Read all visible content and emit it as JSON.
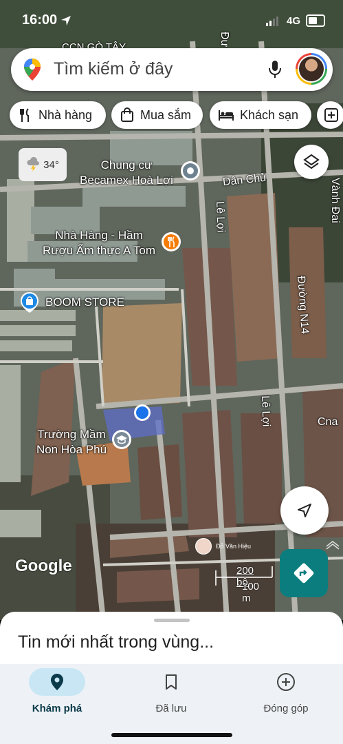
{
  "status_bar": {
    "time": "16:00",
    "network": "4G"
  },
  "search": {
    "placeholder": "Tìm kiếm ở đây"
  },
  "chips": [
    {
      "label": "Nhà hàng",
      "icon": "fork-knife-icon"
    },
    {
      "label": "Mua sắm",
      "icon": "shopping-bag-icon"
    },
    {
      "label": "Khách sạn",
      "icon": "bed-icon"
    },
    {
      "label": "",
      "icon": "plus-box-icon"
    }
  ],
  "weather": {
    "temperature": "34°",
    "icon": "thunderstorm-icon"
  },
  "map_labels": {
    "top_clipped": "CCN GÒ TÂY",
    "condo_line1": "Chung cư",
    "condo_line2": "Becamex Hoà Lợi",
    "restaurant_line1": "Nhà Hàng - Hầm",
    "restaurant_line2": "Rượu Ẩm thực A Tom",
    "store": "BOOM STORE",
    "school_line1": "Trường Mầm",
    "school_line2": "Non Hòa Phú",
    "cna": "Cna"
  },
  "road_labels": {
    "dan_chu": "Dân Chủ",
    "le_loi_1": "Lê Lợi",
    "le_loi_2": "Lê Lợi",
    "duong_n14": "Đường N14",
    "vanh_dai": "Vành Đai",
    "duong_top": "Đư"
  },
  "attribution": {
    "google": "Google",
    "contributor": "Đỗ Văn Hiệu",
    "scale_ft": "200 bộ",
    "scale_m": "100 m"
  },
  "sheet": {
    "title": "Tin mới nhất trong vùng..."
  },
  "bottom_nav": [
    {
      "label": "Khám phá",
      "icon": "explore-pin-icon",
      "active": true
    },
    {
      "label": "Đã lưu",
      "icon": "bookmark-icon",
      "active": false
    },
    {
      "label": "Đóng góp",
      "icon": "add-circle-icon",
      "active": false
    }
  ],
  "colors": {
    "accent_teal": "#0b7d7e",
    "active_pill": "#c8e6f4",
    "location_blue": "#1a73e8",
    "restaurant_orange": "#f57c00",
    "shop_blue": "#1e88e5"
  }
}
